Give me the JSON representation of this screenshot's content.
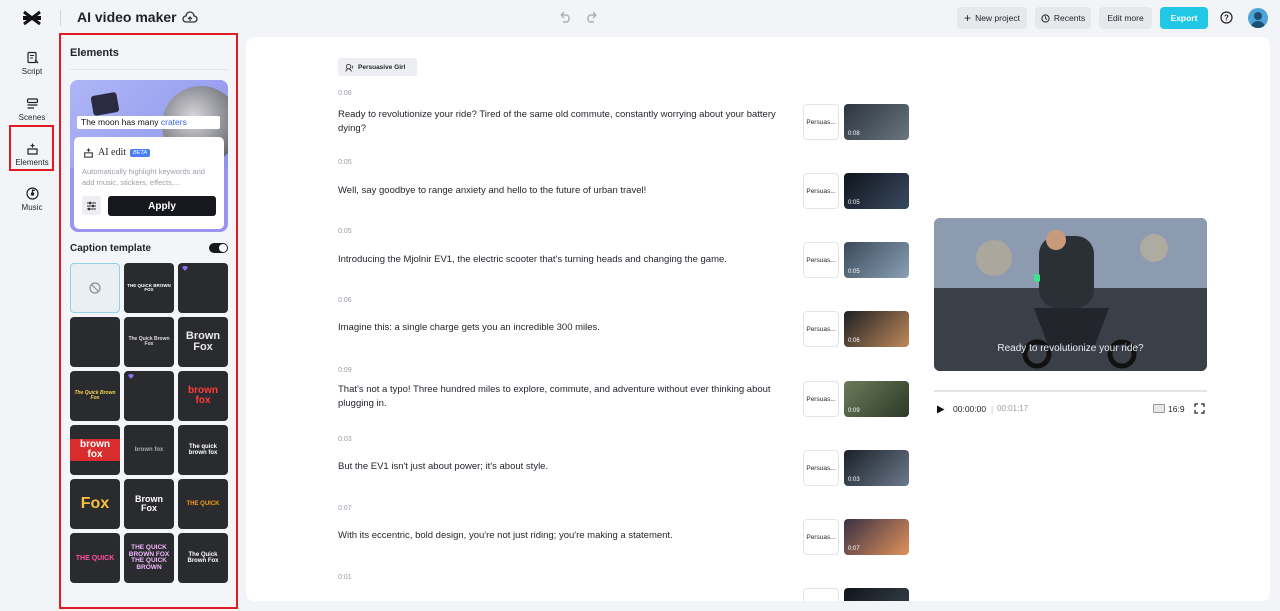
{
  "header": {
    "app_title": "AI video maker",
    "new_project": "New project",
    "recents": "Recents",
    "edit_more": "Edit more",
    "export": "Export"
  },
  "rail": [
    {
      "label": "Script",
      "icon": "script-icon"
    },
    {
      "label": "Scenes",
      "icon": "scenes-icon"
    },
    {
      "label": "Elements",
      "icon": "elements-icon"
    },
    {
      "label": "Music",
      "icon": "music-icon"
    }
  ],
  "panel": {
    "title": "Elements",
    "ai_card": {
      "caption_text": "The moon has many",
      "caption_keyword": "craters",
      "title": "AI edit",
      "badge": "BETA",
      "description": "Automatically highlight keywords and add music, stickers, effects,...",
      "apply": "Apply"
    },
    "caption_template_label": "Caption template",
    "caption_template_enabled": true,
    "templates": [
      {
        "text": "",
        "style": "none"
      },
      {
        "text": "THE QUICK BROWN FOX",
        "style": "plain-small"
      },
      {
        "text": "",
        "style": "blank",
        "premium": true
      },
      {
        "text": "",
        "style": "blank"
      },
      {
        "text": "The Quick Brown Fox",
        "style": "mixed"
      },
      {
        "text": "Brown Fox",
        "style": "brown-3d"
      },
      {
        "text": "The Quick Brown Fox",
        "style": "yellow-script"
      },
      {
        "text": "",
        "style": "blank",
        "premium": true
      },
      {
        "text": "brown fox",
        "style": "red-outline"
      },
      {
        "text": "brown fox",
        "style": "red-block"
      },
      {
        "text": "brown fox",
        "style": "dim"
      },
      {
        "text": "The quick brown fox",
        "style": "orange-accent"
      },
      {
        "text": "Fox",
        "style": "yellow-big"
      },
      {
        "text": "Brown Fox",
        "style": "white-bold"
      },
      {
        "text": "THE QUICK",
        "style": "orange-small"
      },
      {
        "text": "THE QUICK",
        "style": "pink"
      },
      {
        "text": "THE QUICK BROWN FOX THE QUICK BROWN",
        "style": "purple-stack"
      },
      {
        "text": "The Quick Brown Fox",
        "style": "white-serif"
      }
    ]
  },
  "script": {
    "voice": "Persuasive Girl",
    "persona_label": "Persuas...",
    "scenes": [
      {
        "duration": "0:08",
        "text": "Ready to revolutionize your ride? Tired of the same old commute, constantly worrying about your battery dying?",
        "thumb_time": "0:08"
      },
      {
        "duration": "0:05",
        "text": "Well, say goodbye to range anxiety and hello to the future of urban travel!",
        "thumb_time": "0:05"
      },
      {
        "duration": "0:05",
        "text": "Introducing the Mjolnir EV1, the electric scooter that's turning heads and changing the game.",
        "thumb_time": "0:05"
      },
      {
        "duration": "0:06",
        "text": "Imagine this: a single charge gets you an incredible 300 miles.",
        "thumb_time": "0:06"
      },
      {
        "duration": "0:09",
        "text": "That's not a typo! Three hundred miles to explore, commute, and adventure without ever thinking about plugging in.",
        "thumb_time": "0:09"
      },
      {
        "duration": "0:03",
        "text": "But the EV1 isn't just about power; it's about style.",
        "thumb_time": "0:03"
      },
      {
        "duration": "0:07",
        "text": "With its eccentric, bold design, you're not just riding; you're making a statement.",
        "thumb_time": "0:07"
      },
      {
        "duration": "0:01",
        "text": "",
        "thumb_time": ""
      }
    ]
  },
  "player": {
    "subtitle": "Ready to revolutionize your ride?",
    "current_time": "00:00:00",
    "separator": "|",
    "total_time": "00:01:17",
    "ratio": "16:9",
    "progress": 0
  }
}
